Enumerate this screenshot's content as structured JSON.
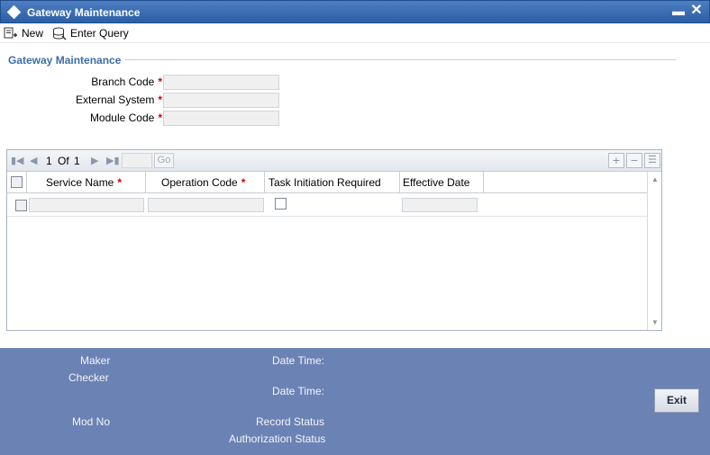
{
  "window": {
    "title": "Gateway Maintenance",
    "minimize_glyph": "▬",
    "close_glyph": "✕"
  },
  "toolbar": {
    "new_label": "New",
    "enter_query_label": "Enter Query"
  },
  "section": {
    "title": "Gateway Maintenance"
  },
  "form": {
    "branch_code": {
      "label": "Branch Code",
      "required": "*",
      "value": ""
    },
    "external_system": {
      "label": "External System",
      "required": "*",
      "value": ""
    },
    "module_code": {
      "label": "Module Code",
      "required": "*",
      "value": ""
    }
  },
  "grid": {
    "pager": {
      "current": "1",
      "of_label": "Of",
      "total": "1",
      "go_label": "Go"
    },
    "columns": [
      {
        "label": "Service Name",
        "required": "*"
      },
      {
        "label": "Operation Code",
        "required": "*"
      },
      {
        "label": "Task Initiation Required",
        "required": ""
      },
      {
        "label": "Effective Date",
        "required": ""
      }
    ],
    "rows": [
      {
        "service_name": "",
        "operation_code": "",
        "task_initiation_required": false,
        "effective_date": ""
      }
    ]
  },
  "footer": {
    "maker_label": "Maker",
    "checker_label": "Checker",
    "date_time_label": "Date Time:",
    "mod_no_label": "Mod No",
    "record_status_label": "Record Status",
    "authorization_status_label": "Authorization Status",
    "exit_label": "Exit"
  },
  "colors": {
    "title_bar": "#2a5ea6",
    "section_title": "#3a6daa",
    "required_marker": "#d40000",
    "footer": "#6b82b5"
  }
}
